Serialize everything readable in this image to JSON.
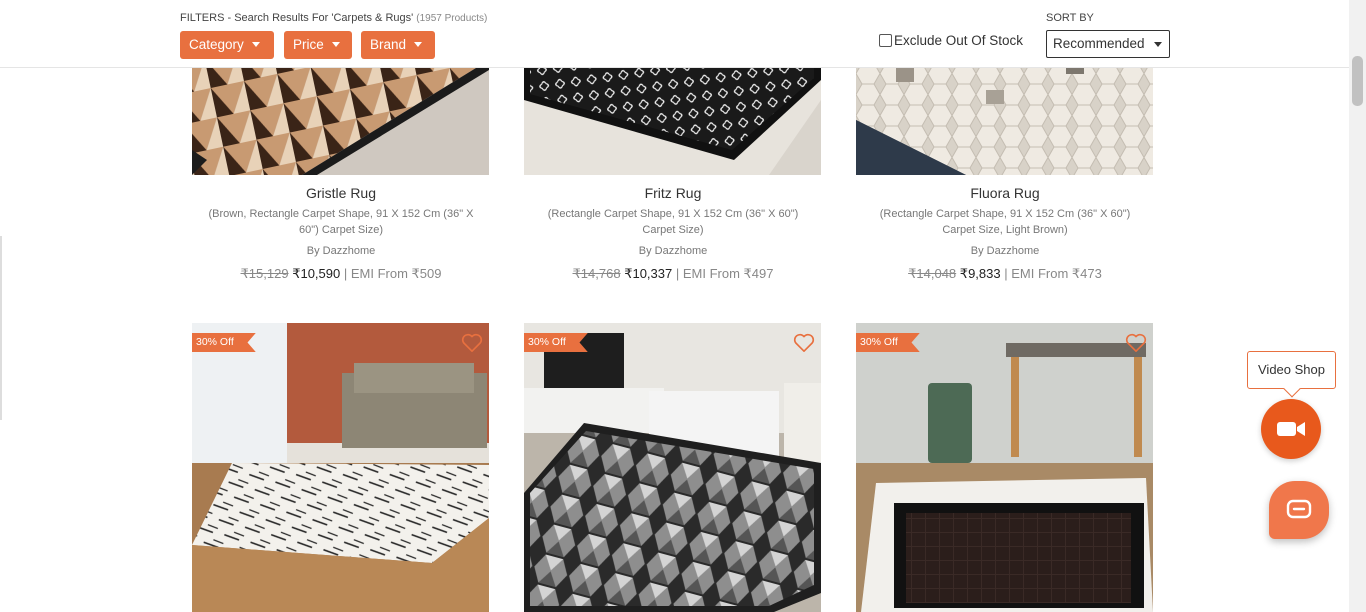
{
  "filters": {
    "title": "FILTERS - Search Results For 'Carpets & Rugs'",
    "count": "(1957 Products)",
    "buttons": [
      "Category",
      "Price",
      "Brand"
    ]
  },
  "stock_filter": {
    "label": "Exclude Out Of Stock",
    "checked": false
  },
  "sort": {
    "label": "SORT BY",
    "selected": "Recommended"
  },
  "products_row1": [
    {
      "name": "Gristle Rug",
      "desc": "(Brown, Rectangle Carpet Shape, 91 X 152 Cm (36\" X 60\") Carpet Size)",
      "brand": "By Dazzhome",
      "mrp": "₹15,129",
      "price": "₹10,590",
      "emi": "| EMI From ₹509"
    },
    {
      "name": "Fritz Rug",
      "desc": "(Rectangle Carpet Shape, 91 X 152 Cm (36\" X 60\") Carpet Size)",
      "brand": "By Dazzhome",
      "mrp": "₹14,768",
      "price": "₹10,337",
      "emi": "| EMI From ₹497"
    },
    {
      "name": "Fluora Rug",
      "desc": "(Rectangle Carpet Shape, 91 X 152 Cm (36\" X 60\") Carpet Size, Light Brown)",
      "brand": "By Dazzhome",
      "mrp": "₹14,048",
      "price": "₹9,833",
      "emi": "| EMI From ₹473"
    }
  ],
  "products_row2": [
    {
      "badge": "30% Off",
      "wishlist_icon": "heart-outline-icon"
    },
    {
      "badge": "30% Off",
      "wishlist_icon": "heart-outline-icon"
    },
    {
      "badge": "30% Off",
      "wishlist_icon": "heart-outline-icon"
    }
  ],
  "video_shop": {
    "label": "Video Shop",
    "icon": "video-camera-icon"
  },
  "chat": {
    "icon": "chat-icon"
  },
  "colors": {
    "accent": "#e8703f",
    "video_button": "#e8591c"
  }
}
